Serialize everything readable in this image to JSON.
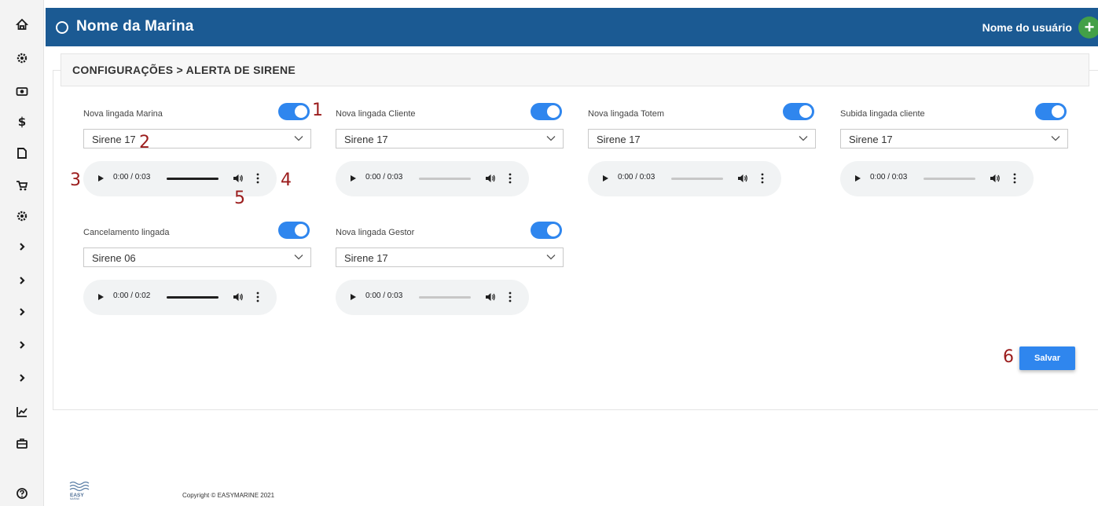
{
  "header": {
    "marina_name": "Nome da Marina",
    "user_name": "Nome do usuário",
    "add_symbol": "+"
  },
  "sidebar": {
    "items": [
      {
        "icon": "home-icon"
      },
      {
        "icon": "settings-icon"
      },
      {
        "icon": "camera-icon"
      },
      {
        "icon": "dollar-icon",
        "text": "$"
      },
      {
        "icon": "document-icon"
      },
      {
        "icon": "cart-icon"
      },
      {
        "icon": "settings-icon"
      },
      {
        "icon": "chevron-right-icon"
      },
      {
        "icon": "chevron-right-icon"
      },
      {
        "icon": "chevron-right-icon"
      },
      {
        "icon": "chevron-right-icon"
      },
      {
        "icon": "chevron-right-icon"
      },
      {
        "icon": "chart-icon"
      },
      {
        "icon": "briefcase-icon"
      },
      {
        "icon": "help-icon"
      }
    ]
  },
  "breadcrumb": "CONFIGURAÇÕES > ALERTA DE SIRENE",
  "alerts": [
    {
      "label": "Nova lingada Marina",
      "selected": "Sirene 17",
      "time": "0:00 / 0:03",
      "progress": 100,
      "enabled": true
    },
    {
      "label": "Nova lingada Cliente",
      "selected": "Sirene 17",
      "time": "0:00 / 0:03",
      "progress": 0,
      "enabled": true
    },
    {
      "label": "Nova lingada Totem",
      "selected": "Sirene 17",
      "time": "0:00 / 0:03",
      "progress": 0,
      "enabled": true
    },
    {
      "label": "Subida lingada cliente",
      "selected": "Sirene 17",
      "time": "0:00 / 0:03",
      "progress": 0,
      "enabled": true
    },
    {
      "label": "Cancelamento lingada",
      "selected": "Sirene 06",
      "time": "0:00 / 0:02",
      "progress": 100,
      "enabled": true
    },
    {
      "label": "Nova lingada Gestor",
      "selected": "Sirene 17",
      "time": "0:00 / 0:03",
      "progress": 0,
      "enabled": true
    }
  ],
  "annotations": [
    "1",
    "2",
    "3",
    "4",
    "5",
    "6"
  ],
  "save_label": "Salvar",
  "footer": {
    "logo_text": "EASY MARINE",
    "copyright": "Copyright © EASYMARINE 2021"
  },
  "colors": {
    "header": "#1b5a93",
    "accent": "#2f86ee",
    "add_button": "#43a047",
    "annotation": "#9b1c1c"
  }
}
